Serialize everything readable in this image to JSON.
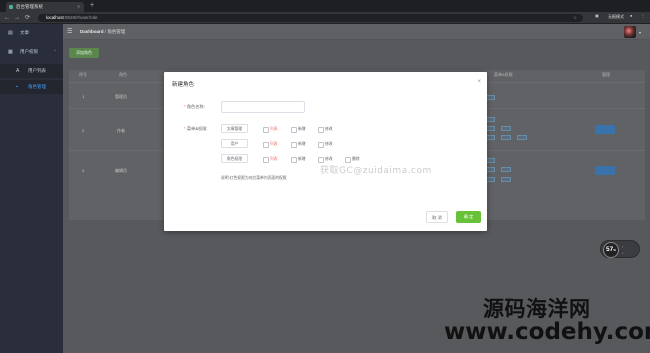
{
  "browser": {
    "tab_title": "后台管理系统",
    "url_host": "localhost",
    "url_path": ":9528/#/user/role",
    "incognito_label": "无痕模式"
  },
  "sidebar": {
    "items": [
      {
        "label": "文章",
        "icon": "document-icon"
      },
      {
        "label": "用户权限",
        "icon": "grid-icon"
      },
      {
        "label": "用户列表",
        "icon": "user-icon"
      },
      {
        "label": "角色管理",
        "icon": "role-icon"
      }
    ]
  },
  "header": {
    "breadcrumb_root": "Dashboard",
    "breadcrumb_sep": "/",
    "breadcrumb_current": "角色管理"
  },
  "main": {
    "add_button_label": "添加角色",
    "table": {
      "headers": [
        "序号",
        "角色",
        "菜单&权限",
        "管理"
      ],
      "rows": [
        {
          "index": "1",
          "role": "管理员"
        },
        {
          "index": "2",
          "role": "作者"
        },
        {
          "index": "3",
          "role": "编辑员"
        }
      ]
    }
  },
  "dialog": {
    "title": "新建角色",
    "close_icon": "close-icon",
    "role_name_label": "角色名称:",
    "menu_perm_label": "菜单&权限:",
    "required_mark": "*",
    "modules": [
      {
        "label": "文章管理",
        "perms": [
          {
            "label": "列表",
            "highlight": true
          },
          {
            "label": "新增"
          },
          {
            "label": "修改"
          }
        ]
      },
      {
        "label": "用户",
        "perms": [
          {
            "label": "列表",
            "highlight": true
          },
          {
            "label": "新增"
          },
          {
            "label": "修改"
          }
        ]
      },
      {
        "label": "角色权限",
        "perms": [
          {
            "label": "列表",
            "highlight": true
          },
          {
            "label": "新增"
          },
          {
            "label": "修改"
          },
          {
            "label": "删除"
          }
        ]
      }
    ],
    "hint": "说明:红色权限为对应菜单内页面的权限",
    "watermark": "获取GC@zuidaima.com",
    "cancel_label": "取 消",
    "ok_label": "确 定"
  },
  "speed_widget": {
    "value": "57",
    "unit": "%"
  },
  "brand_watermark": {
    "line1": "源码海洋网",
    "line2": "www.codehy.com"
  },
  "colors": {
    "primary": "#409eff",
    "success": "#67c23a",
    "danger": "#f56c6c",
    "sidebar_bg": "#2a2e3a"
  }
}
